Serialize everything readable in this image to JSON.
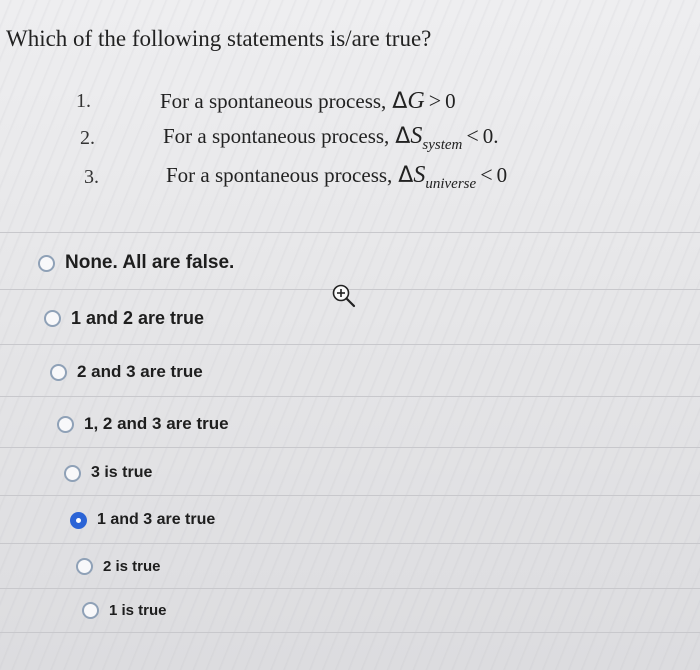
{
  "question": "Which of the following statements is/are true?",
  "statements": [
    {
      "number": "1.",
      "prefix": "For a spontaneous process,",
      "symbol": "Δ",
      "variable": "G",
      "subscript": "",
      "operator": ">",
      "value": "0"
    },
    {
      "number": "2.",
      "prefix": "For a spontaneous process,",
      "symbol": "Δ",
      "variable": "S",
      "subscript": "system",
      "operator": "<",
      "value": "0."
    },
    {
      "number": "3.",
      "prefix": "For a spontaneous process,",
      "symbol": "Δ",
      "variable": "S",
      "subscript": "universe",
      "operator": "<",
      "value": "0"
    }
  ],
  "options": [
    {
      "label": "None. All are false.",
      "selected": false
    },
    {
      "label": "1 and 2 are true",
      "selected": false
    },
    {
      "label": "2 and 3 are true",
      "selected": false
    },
    {
      "label": "1, 2 and 3 are true",
      "selected": false
    },
    {
      "label": "3 is true",
      "selected": false
    },
    {
      "label": "1 and 3 are true",
      "selected": true
    },
    {
      "label": "2 is true",
      "selected": false
    },
    {
      "label": "1 is true",
      "selected": false
    }
  ],
  "colors": {
    "selected_radio": "#2b64d6",
    "radio_border": "#8fa1b7"
  },
  "icons": {
    "zoom": "zoom-in-icon"
  }
}
